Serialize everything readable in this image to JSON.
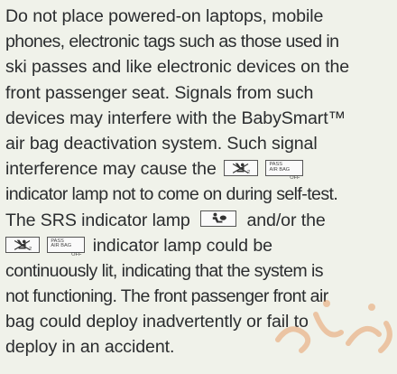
{
  "paragraph": {
    "lines": [
      "Do not place powered-on laptops, mobile",
      "phones, electronic tags such as those used in",
      "ski passes and like electronic devices on the",
      "front passenger seat. Signals from such",
      "devices may interfere with the BabySmart™",
      "air bag deactivation system. Such signal",
      "interference may cause the",
      "indicator lamp not to come on during self-test.",
      "The SRS indicator lamp",
      "and/or the",
      "indicator lamp could be",
      "continuously lit, indicating that the system is",
      "not functioning. The front passenger front air",
      "bag could deploy inadvertently or fail to",
      "deploy in an accident."
    ]
  },
  "icons": {
    "child_seat": "child-seat-airbag-off-icon",
    "passenger_airbag_off": "passenger-airbag-off-icon",
    "srs": "srs-airbag-icon",
    "pass_label_line1": "PASS",
    "pass_label_line2": "AIR BAG",
    "pass_label_off": "OFF"
  },
  "colors": {
    "background": "#f0f2ea",
    "text": "#2b2d2f",
    "watermark": "#e7a06a"
  }
}
